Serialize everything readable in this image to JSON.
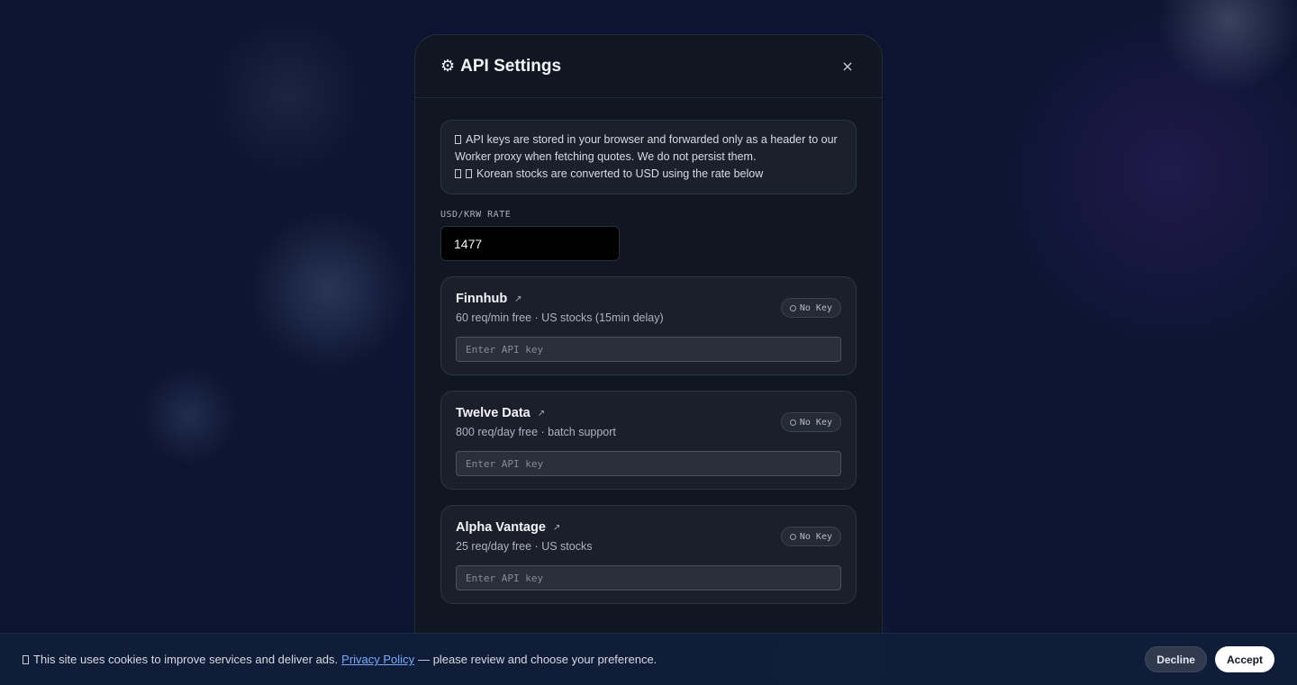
{
  "modal": {
    "title": "API Settings",
    "title_icon": "gear-icon",
    "close_label": "×",
    "notice": {
      "line1": "API keys are stored in your browser and forwarded only as a header to our Worker proxy when fetching quotes. We do not persist them.",
      "line2": "Korean stocks are converted to USD using the rate below"
    },
    "rate": {
      "label": "USD/KRW RATE",
      "value": "1477"
    },
    "providers": [
      {
        "name": "Finnhub",
        "link_icon": "↗",
        "description": "60 req/min free · US stocks (15min delay)",
        "status": "No Key",
        "placeholder": "Enter API key"
      },
      {
        "name": "Twelve Data",
        "link_icon": "↗",
        "description": "800 req/day free · batch support",
        "status": "No Key",
        "placeholder": "Enter API key"
      },
      {
        "name": "Alpha Vantage",
        "link_icon": "↗",
        "description": "25 req/day free · US stocks",
        "status": "No Key",
        "placeholder": "Enter API key"
      }
    ]
  },
  "cookie": {
    "text_before": "This site uses cookies to improve services and deliver ads.",
    "link": "Privacy Policy",
    "text_after": "— please review and choose your preference.",
    "decline": "Decline",
    "accept": "Accept"
  }
}
